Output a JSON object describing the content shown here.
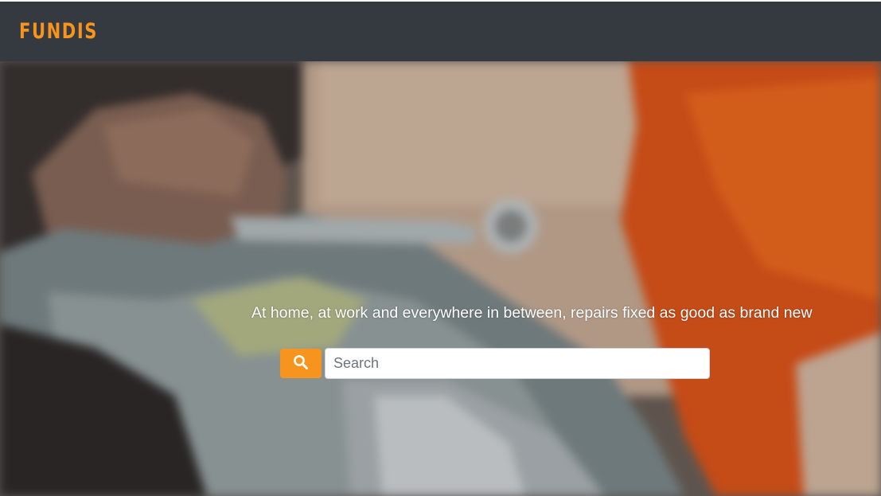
{
  "brand": {
    "logo_text": "FUNDIS",
    "logo_color": "#f7941d"
  },
  "navbar": {
    "background": "#343a40"
  },
  "hero": {
    "tagline": "At home, at work and everywhere in between, repairs fixed as good as brand new",
    "background_image": "mechanic-wrench-photo",
    "search": {
      "button_icon": "search-icon",
      "button_color": "#f7941d",
      "placeholder": "Search",
      "value": ""
    }
  }
}
